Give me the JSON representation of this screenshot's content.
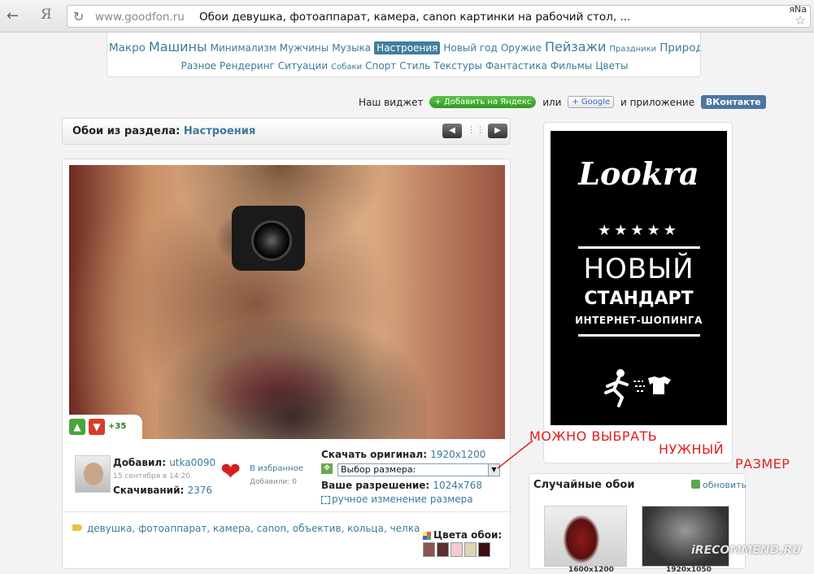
{
  "browser": {
    "back_icon": "arrow-left-icon",
    "ya_label": "Я",
    "url_host": "www.goodfon.ru",
    "page_title": "Обои девушка, фотоаппарат, камера, canon картинки на рабочий стол, ...",
    "corner_text": "яNa"
  },
  "tags": {
    "row1": [
      {
        "label": "Макро",
        "size": "l"
      },
      {
        "label": "Машины",
        "size": "xl"
      },
      {
        "label": "Минимализм",
        "size": "m"
      },
      {
        "label": "Мужчины",
        "size": "m"
      },
      {
        "label": "Музыка",
        "size": "m"
      },
      {
        "label": "Настроения",
        "size": "m",
        "active": true
      },
      {
        "label": "Новый год",
        "size": "m"
      },
      {
        "label": "Оружие",
        "size": "m"
      },
      {
        "label": "Пейзажи",
        "size": "xl"
      },
      {
        "label": "Праздники",
        "size": "s"
      },
      {
        "label": "Природа",
        "size": "l"
      }
    ],
    "row2": [
      {
        "label": "Разное",
        "size": "m"
      },
      {
        "label": "Рендеринг",
        "size": "m"
      },
      {
        "label": "Ситуации",
        "size": "m"
      },
      {
        "label": "Собаки",
        "size": "s"
      },
      {
        "label": "Спорт",
        "size": "m"
      },
      {
        "label": "Стиль",
        "size": "m"
      },
      {
        "label": "Текстуры",
        "size": "m"
      },
      {
        "label": "Фантастика",
        "size": "m"
      },
      {
        "label": "Фильмы",
        "size": "m"
      },
      {
        "label": "Цветы",
        "size": "m"
      }
    ]
  },
  "widget": {
    "prefix": "Наш виджет",
    "yandex_label": "+ Добавить на Яндекс",
    "or_label": "или",
    "google_label": "+ Google",
    "app_label": "и приложение",
    "vk_label": "ВКонтакте"
  },
  "section": {
    "prefix": "Обои из раздела:",
    "name": "Настроения"
  },
  "wallpaper": {
    "votes": "+35",
    "added_label": "Добавил:",
    "user": "utka0090",
    "date": "15 сентября в 14:20",
    "downloads_label": "Скачиваний:",
    "downloads": "2376",
    "fav_label": "В избранное",
    "fav_count_label": "Добавили: 0",
    "orig_label": "Скачать оригинал:",
    "orig_res": "1920x1200",
    "size_select": "Выбор размера:",
    "your_res_label": "Ваше разрешение:",
    "your_res": "1024x768",
    "manual_resize": "ручное изменение размера",
    "tags_text": "девушка, фотоаппарат, камера, canon, объектив, кольца, челка",
    "colors_label": "Цвета обои:",
    "colors": [
      "#8a5555",
      "#5a3030",
      "#f3c9d2",
      "#dcd7b0",
      "#3a1010"
    ]
  },
  "ad": {
    "logo": "Lookra",
    "stars": "★★★★★",
    "line1": "НОВЫЙ",
    "line2": "СТАНДАРТ",
    "line3": "ИНТЕРНЕТ-ШОПИНГА"
  },
  "annotation": {
    "line1": "МОЖНО ВЫБРАТЬ",
    "line2": "НУЖНЫЙ",
    "line3": "РАЗМЕР",
    "color": "#e02020"
  },
  "random": {
    "title": "Случайные обои",
    "refresh": "обновить",
    "thumb1_caption": "1600x1200",
    "thumb2_caption": "1920x1050"
  },
  "watermark": "iRECOMMEND.RU"
}
